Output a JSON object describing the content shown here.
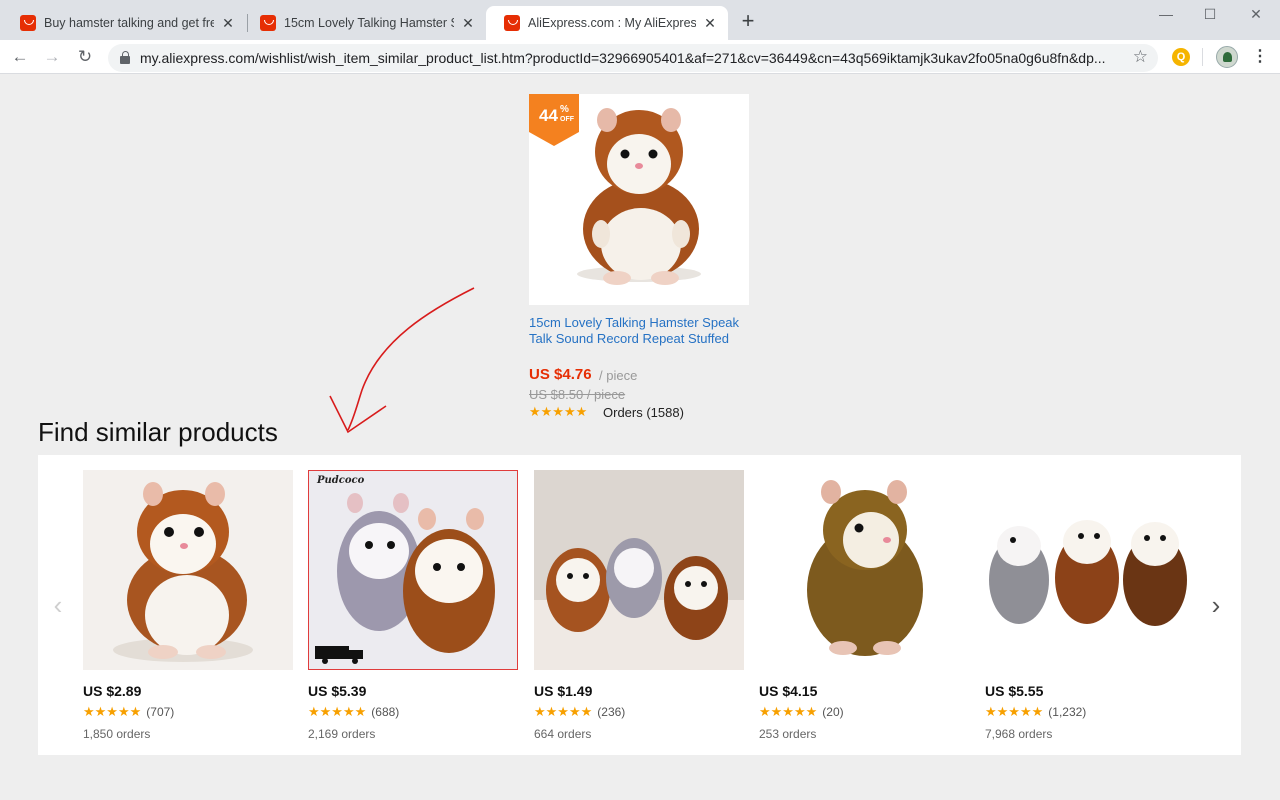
{
  "browser": {
    "tabs": [
      {
        "title": "Buy hamster talking and get free",
        "active": false
      },
      {
        "title": "15cm Lovely Talking Hamster Spe",
        "active": false
      },
      {
        "title": "AliExpress.com : My AliExpress",
        "active": true
      }
    ],
    "url": "my.aliexpress.com/wishlist/wish_item_similar_product_list.htm?productId=32966905401&af=271&cv=36449&cn=43q569iktamjk3ukav2fo05na0g6u8fn&dp..."
  },
  "product": {
    "discount": "44",
    "discount_pct": "%",
    "discount_off": "OFF",
    "title": "15cm Lovely Talking Hamster Speak Talk Sound Record Repeat Stuffed",
    "price": "US $4.76",
    "unit": "/ piece",
    "original_price": "US $8.50 / piece",
    "stars": "★★★★★",
    "orders": "Orders (1588)"
  },
  "similar": {
    "heading": "Find similar products",
    "items": [
      {
        "price": "US $2.89",
        "stars": "★★★★★",
        "reviews": "(707)",
        "orders": "1,850 orders"
      },
      {
        "price": "US $5.39",
        "stars": "★★★★★",
        "reviews": "(688)",
        "orders": "2,169 orders",
        "brand": "Pudcoco"
      },
      {
        "price": "US $1.49",
        "stars": "★★★★★",
        "reviews": "(236)",
        "orders": "664 orders"
      },
      {
        "price": "US $4.15",
        "stars": "★★★★★",
        "reviews": "(20)",
        "orders": "253 orders"
      },
      {
        "price": "US $5.55",
        "stars": "★★★★★",
        "reviews": "(1,232)",
        "orders": "7,968 orders"
      }
    ]
  },
  "colors": {
    "accent": "#e62e04",
    "link": "#2672c4",
    "star": "#f7a000",
    "badge": "#f4811f"
  }
}
